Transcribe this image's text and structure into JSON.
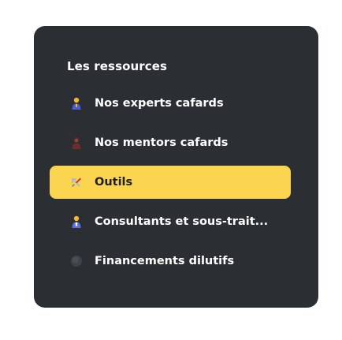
{
  "menu": {
    "title": "Les ressources",
    "items": [
      {
        "label": "Nos experts cafards",
        "icon": "expert-person-icon",
        "active": false
      },
      {
        "label": "Nos mentors cafards",
        "icon": "mentor-person-icon",
        "active": false
      },
      {
        "label": "Outils",
        "icon": "tools-icon",
        "active": true
      },
      {
        "label": "Consultants et sous-trait...",
        "icon": "consultant-person-icon",
        "active": false
      },
      {
        "label": "Financements dilutifs",
        "icon": "dark-circle-icon",
        "active": false
      }
    ]
  },
  "colors": {
    "card_background": "#2b2e33",
    "active_background": "#fbd54f",
    "text": "#ffffff",
    "active_text": "#1f1f1f"
  }
}
